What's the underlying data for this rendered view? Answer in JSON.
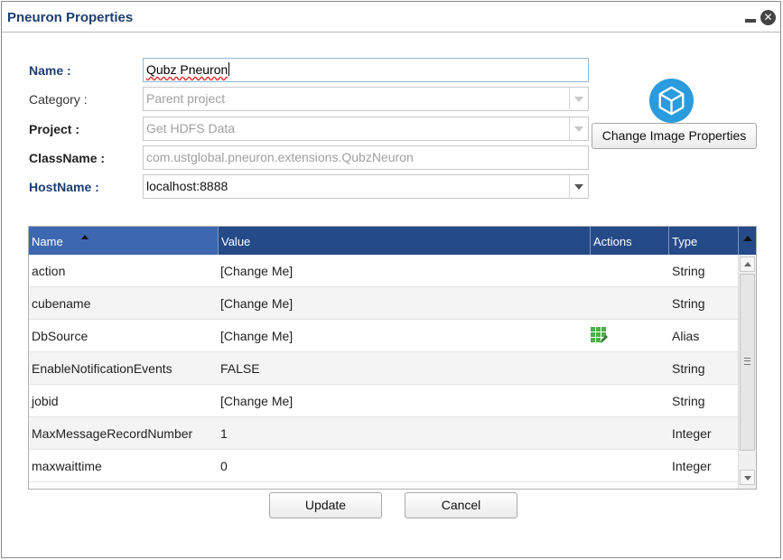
{
  "window": {
    "title": "Pneuron Properties",
    "minimize_icon": "minimize-icon",
    "close_icon": "close-icon",
    "close_glyph": "✕"
  },
  "form": {
    "name": {
      "label": "Name :",
      "value": "Qubz Pneuron"
    },
    "category": {
      "label": "Category :",
      "value": "Parent project"
    },
    "project": {
      "label": "Project :",
      "value": "Get HDFS Data"
    },
    "classname": {
      "label": "ClassName :",
      "value": "com.ustglobal.pneuron.extensions.QubzNeuron"
    },
    "hostname": {
      "label": "HostName :",
      "value": "localhost:8888"
    }
  },
  "image": {
    "icon": "cube-icon",
    "change_button": "Change Image Properties"
  },
  "grid": {
    "columns": [
      "Name",
      "Value",
      "Actions",
      "Type"
    ],
    "sorted_column": "Name",
    "rows": [
      {
        "name": "action",
        "value": "[Change Me]",
        "action_icon": "",
        "type": "String"
      },
      {
        "name": "cubename",
        "value": "[Change Me]",
        "action_icon": "",
        "type": "String"
      },
      {
        "name": "DbSource",
        "value": "[Change Me]",
        "action_icon": "grid-edit-icon",
        "type": "Alias"
      },
      {
        "name": "EnableNotificationEvents",
        "value": "FALSE",
        "action_icon": "",
        "type": "String"
      },
      {
        "name": "jobid",
        "value": "[Change Me]",
        "action_icon": "",
        "type": "String"
      },
      {
        "name": "MaxMessageRecordNumber",
        "value": "1",
        "action_icon": "",
        "type": "Integer"
      },
      {
        "name": "maxwaittime",
        "value": "0",
        "action_icon": "",
        "type": "Integer"
      }
    ]
  },
  "footer": {
    "update": "Update",
    "cancel": "Cancel"
  },
  "colors": {
    "title": "#1c3f73",
    "grid_header": "#244a88",
    "sorted_header": "#3d67b0",
    "cube_icon": "#2a9bdc",
    "alias_icon": "#4cae4c"
  }
}
